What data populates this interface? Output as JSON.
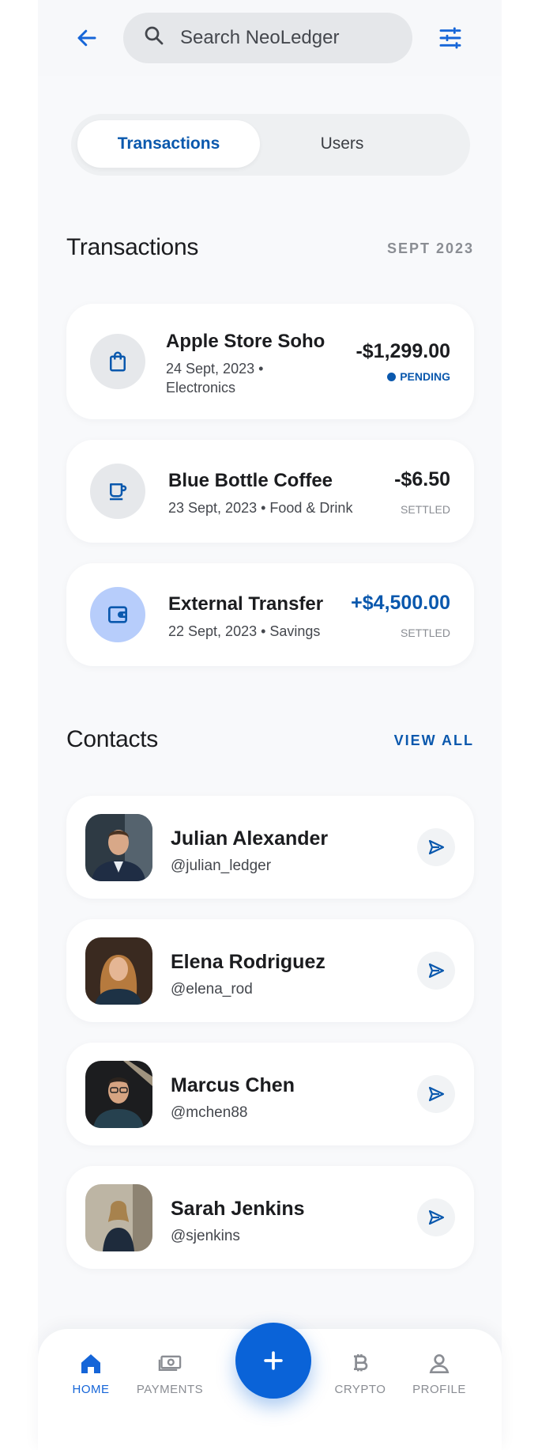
{
  "search": {
    "placeholder": "Search NeoLedger"
  },
  "tabs": [
    {
      "label": "Transactions",
      "active": true
    },
    {
      "label": "Users",
      "active": false
    }
  ],
  "transactions_section": {
    "title": "Transactions",
    "period": "SEPT 2023",
    "items": [
      {
        "name": "Apple Store Soho",
        "meta_line1": "24 Sept, 2023 •",
        "meta_line2": "Electronics",
        "amount": "-$1,299.00",
        "status": "PENDING",
        "icon": "shopping-bag-icon"
      },
      {
        "name": "Blue Bottle Coffee",
        "meta_line1": "23 Sept, 2023 • Food & Drink",
        "amount": "-$6.50",
        "status": "SETTLED",
        "icon": "coffee-cup-icon"
      },
      {
        "name": "External Transfer",
        "meta_line1": "22 Sept, 2023 • Savings",
        "amount": "+$4,500.00",
        "status": "SETTLED",
        "icon": "wallet-icon"
      }
    ]
  },
  "contacts_section": {
    "title": "Contacts",
    "view_all": "VIEW ALL",
    "items": [
      {
        "name": "Julian Alexander",
        "handle": "@julian_ledger"
      },
      {
        "name": "Elena Rodriguez",
        "handle": "@elena_rod"
      },
      {
        "name": "Marcus Chen",
        "handle": "@mchen88"
      },
      {
        "name": "Sarah Jenkins",
        "handle": "@sjenkins"
      }
    ]
  },
  "bottom_nav": {
    "items": [
      {
        "label": "HOME",
        "icon": "home-icon",
        "active": true
      },
      {
        "label": "PAYMENTS",
        "icon": "payments-icon",
        "active": false
      },
      {
        "label": "CRYPTO",
        "icon": "bitcoin-icon",
        "active": false
      },
      {
        "label": "PROFILE",
        "icon": "profile-icon",
        "active": false
      }
    ],
    "fab_icon": "plus-icon"
  },
  "colors": {
    "primary": "#0a58ad",
    "accent": "#0a63d8",
    "muted": "#8a8d93",
    "background": "#f8f9fb"
  }
}
